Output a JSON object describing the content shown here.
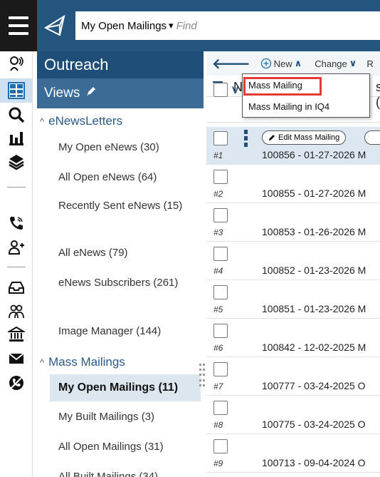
{
  "topbar": {
    "mode_label": "My Open Mailings",
    "mode_caret": "❯",
    "find_placeholder": "Find"
  },
  "nav": {
    "title": "Outreach",
    "views_label": "Views",
    "groups": [
      {
        "label": "eNewsLetters",
        "toggle": "^"
      },
      {
        "label": "Mass Mailings",
        "toggle": "^"
      }
    ],
    "items": [
      {
        "label": "My Open eNews (30)"
      },
      {
        "label": "All Open eNews (64)"
      },
      {
        "label": "Recently Sent eNews (15)"
      },
      {
        "label": "All eNews (79)"
      },
      {
        "label": "eNews Subscribers (261)"
      },
      {
        "label": "Image Manager (144)"
      },
      {
        "label": "My Open Mailings (11)"
      },
      {
        "label": "My Built Mailings (3)"
      },
      {
        "label": "All Open Mailings (31)"
      },
      {
        "label": "All Built Mailings (34)"
      }
    ]
  },
  "toolbar": {
    "new_label": "New",
    "change_label": "Change",
    "r_label": "R"
  },
  "dropdown": {
    "options": [
      "Mass Mailing",
      "Mass Mailing in IQ4"
    ]
  },
  "filter_letter": "N",
  "filter_letter_2": "s (",
  "header_letter": "V",
  "row_actions": {
    "edit_label": "Edit Mass Mailing"
  },
  "rows": [
    {
      "num": "#1",
      "desc": "100856 - 01-27-2026 M"
    },
    {
      "num": "#2",
      "desc": "100855 - 01-27-2026 M"
    },
    {
      "num": "#3",
      "desc": "100853 - 01-26-2026 M"
    },
    {
      "num": "#4",
      "desc": "100852 - 01-23-2026 M"
    },
    {
      "num": "#5",
      "desc": "100851 - 01-23-2026 M"
    },
    {
      "num": "#6",
      "desc": "100842 - 12-02-2025 M"
    },
    {
      "num": "#7",
      "desc": "100777 - 03-24-2025 O"
    },
    {
      "num": "#8",
      "desc": "100775 - 03-24-2025 O"
    },
    {
      "num": "#9",
      "desc": "100713 - 09-04-2024 O"
    }
  ],
  "colors": {
    "brand": "#23557f",
    "nav_header": "#1f4f78",
    "views_bar": "#3c6c95",
    "selected_item": "#dbe6ef",
    "highlight": "#e53935"
  }
}
